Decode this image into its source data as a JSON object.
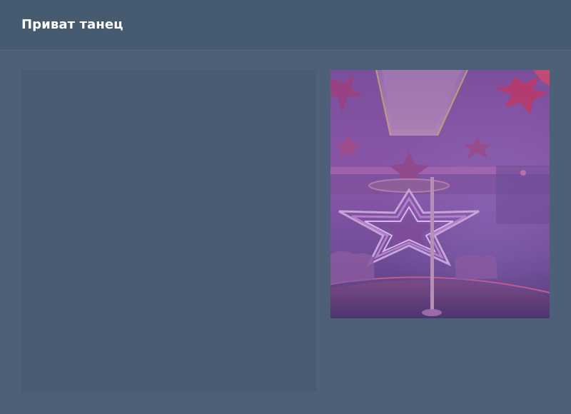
{
  "header": {
    "title": "Приват танец"
  },
  "preview": {
    "icon": "private-dance-room-illustration",
    "accent": "#7a4f9e"
  }
}
